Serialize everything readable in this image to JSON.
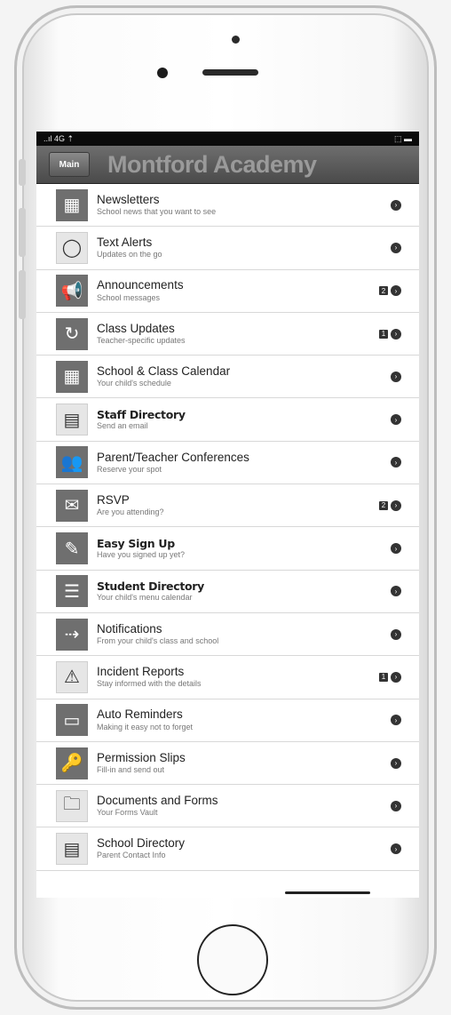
{
  "status": {
    "left": "..ıl 4G ⇡",
    "right": "⬚ ▬"
  },
  "nav": {
    "back_label": "Main",
    "title": "Montford Academy"
  },
  "items": [
    {
      "title": "Newsletters",
      "subtitle": "School news that you want to see",
      "icon": "grid-icon",
      "badge": ""
    },
    {
      "title": "Text Alerts",
      "subtitle": "Updates on the go",
      "icon": "speech-bubble-icon",
      "badge": ""
    },
    {
      "title": "Announcements",
      "subtitle": "School messages",
      "icon": "megaphone-icon",
      "badge": "2"
    },
    {
      "title": "Class Updates",
      "subtitle": "Teacher-specific updates",
      "icon": "refresh-icon",
      "badge": "1"
    },
    {
      "title": "School & Class Calendar",
      "subtitle": "Your child's schedule",
      "icon": "calendar-icon",
      "badge": ""
    },
    {
      "title": "Staff Directory",
      "subtitle": "Send an email",
      "icon": "contact-card-icon",
      "badge": ""
    },
    {
      "title": "Parent/Teacher Conferences",
      "subtitle": "Reserve your spot",
      "icon": "people-icon",
      "badge": ""
    },
    {
      "title": "RSVP",
      "subtitle": "Are you attending?",
      "icon": "envelope-icon",
      "badge": "2"
    },
    {
      "title": "Easy Sign Up",
      "subtitle": "Have you signed up yet?",
      "icon": "edit-icon",
      "badge": ""
    },
    {
      "title": "Student Directory",
      "subtitle": "Your child's menu calendar",
      "icon": "directory-icon",
      "badge": ""
    },
    {
      "title": "Notifications",
      "subtitle": "From your child's class and school",
      "icon": "notification-icon",
      "badge": ""
    },
    {
      "title": "Incident Reports",
      "subtitle": "Stay informed with the details",
      "icon": "warning-icon",
      "badge": "1"
    },
    {
      "title": "Auto Reminders",
      "subtitle": "Making it easy not to forget",
      "icon": "inbox-icon",
      "badge": ""
    },
    {
      "title": "Permission Slips",
      "subtitle": "Fill-in and send out",
      "icon": "key-icon",
      "badge": ""
    },
    {
      "title": "Documents and Forms",
      "subtitle": "Your Forms Vault",
      "icon": "folder-icon",
      "badge": ""
    },
    {
      "title": "School Directory",
      "subtitle": "Parent Contact Info",
      "icon": "address-card-icon",
      "badge": ""
    }
  ]
}
